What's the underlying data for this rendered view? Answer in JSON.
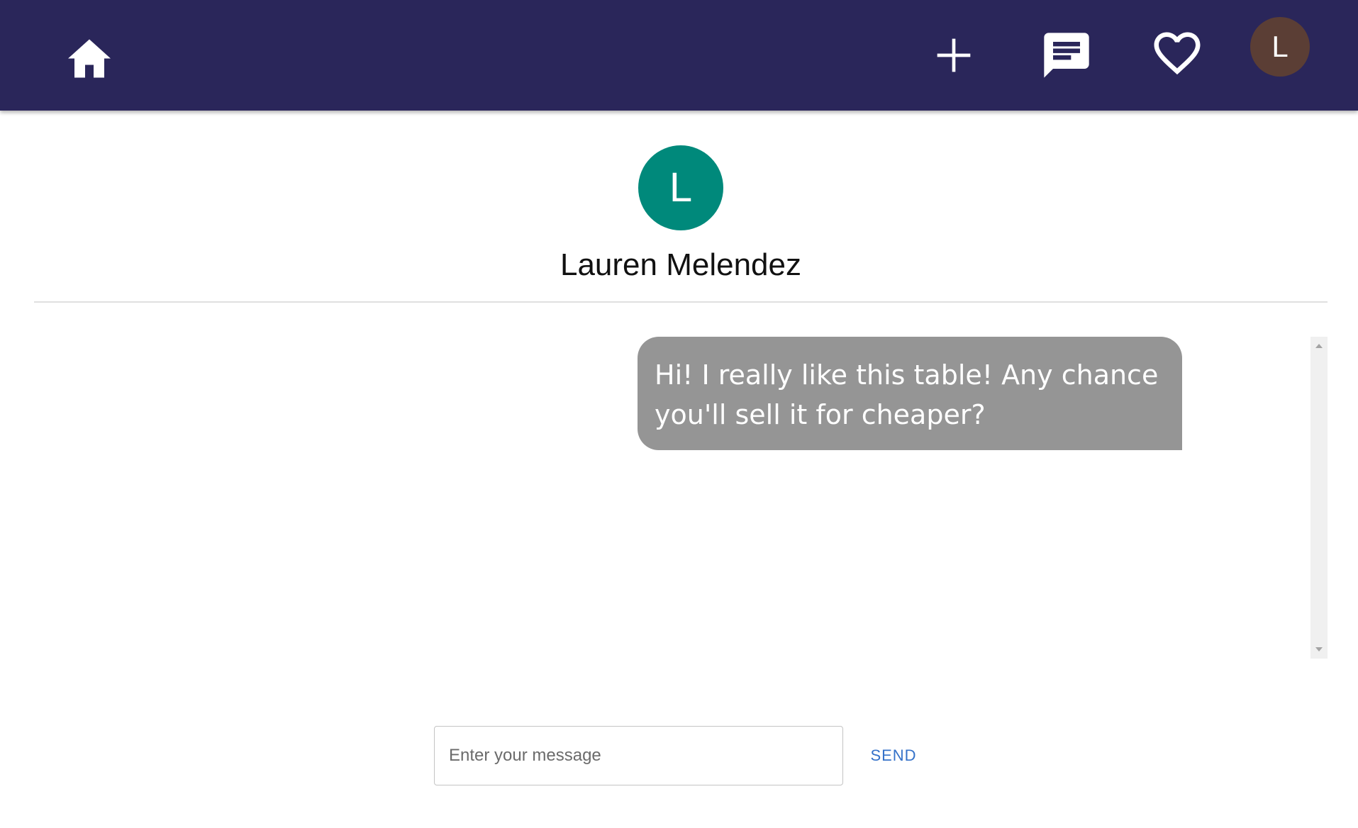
{
  "header": {
    "icons": {
      "home": "home-icon",
      "add": "plus-icon",
      "messages": "chat-icon",
      "favorites": "heart-icon"
    },
    "account_initial": "L",
    "background_color": "#2a265a",
    "account_color": "#5b3e35"
  },
  "conversation": {
    "contact_initial": "L",
    "contact_name": "Lauren Melendez",
    "contact_color": "#00897b",
    "messages": [
      {
        "text": "Hi! I really like this table! Any chance you'll sell it for cheaper?",
        "sender": "me"
      }
    ]
  },
  "composer": {
    "placeholder": "Enter your message",
    "value": "",
    "send_label": "SEND",
    "send_color": "#3572c9"
  }
}
